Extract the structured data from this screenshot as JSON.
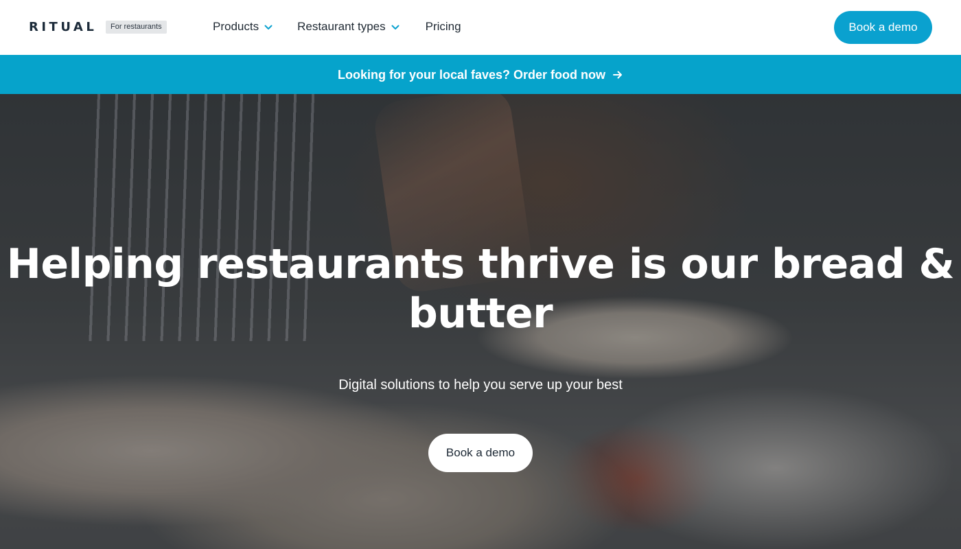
{
  "header": {
    "logo_text": "RITUAL",
    "badge": "For restaurants",
    "nav": [
      {
        "label": "Products",
        "has_dropdown": true
      },
      {
        "label": "Restaurant types",
        "has_dropdown": true
      },
      {
        "label": "Pricing",
        "has_dropdown": false
      }
    ],
    "cta_label": "Book a demo"
  },
  "banner": {
    "text": "Looking for your local faves? Order food now",
    "icon": "arrow-right-icon"
  },
  "hero": {
    "title": "Helping restaurants thrive is our bread & butter",
    "subtitle": "Digital solutions to help you serve up your best",
    "cta_label": "Book a demo",
    "background": "photo of hands rolling dough on a floured counter"
  },
  "colors": {
    "accent": "#0aa1cf",
    "banner": "#06a3cb",
    "text_dark": "#1f2933",
    "white": "#ffffff"
  }
}
